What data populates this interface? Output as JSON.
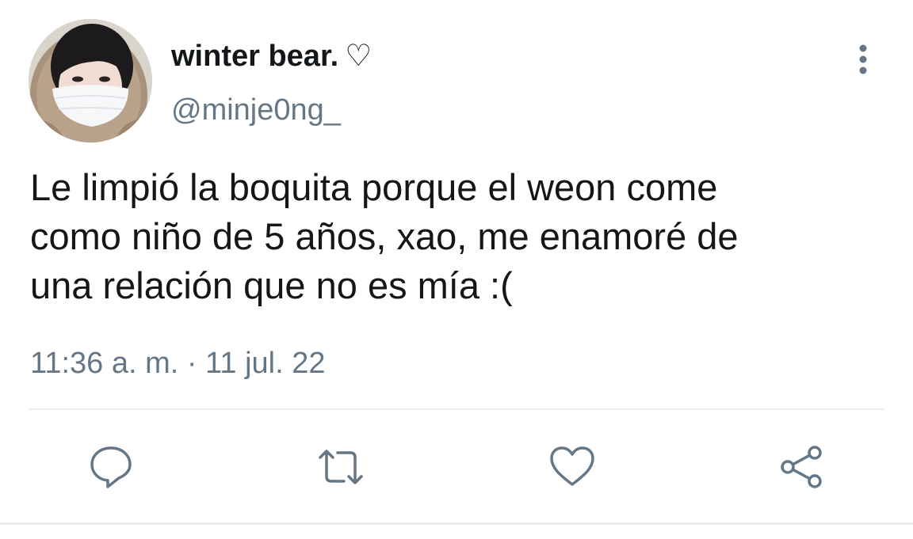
{
  "tweet": {
    "author": {
      "display_name": "winter bear.",
      "name_emoji": "♡",
      "handle": "@minje0ng_",
      "avatar_icon": "profile-photo"
    },
    "text_lines": [
      "Le limpió la boquita porque el weon come",
      "como niño de 5 años, xao, me enamoré de",
      "una relación que no es mía :("
    ],
    "timestamp": "11:36 a. m. · 11 jul. 22"
  },
  "actions": {
    "reply_icon": "reply-icon",
    "retweet_icon": "retweet-icon",
    "like_icon": "like-icon",
    "share_icon": "share-icon",
    "more_icon": "more-vertical-icon"
  },
  "colors": {
    "text_primary": "#14171a",
    "text_secondary": "#657786",
    "icon_gray": "#657786",
    "divider": "#e6ecf0"
  }
}
